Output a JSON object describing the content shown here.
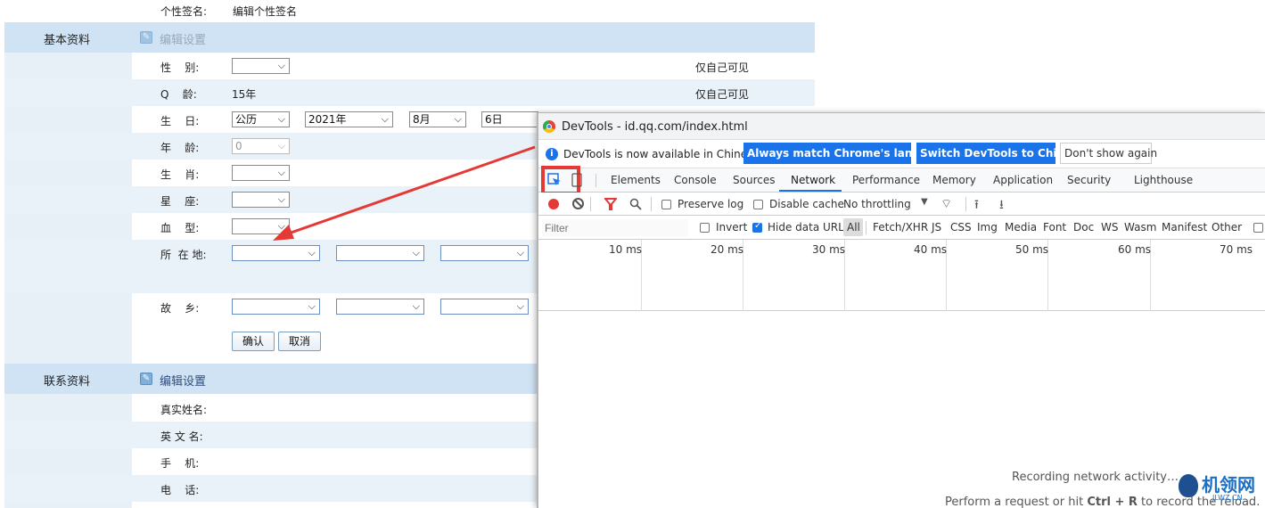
{
  "profile": {
    "signature_label": "个性签名:",
    "signature_value": "编辑个性签名",
    "basic_section": "基本资料",
    "edit_settings": "编辑设置",
    "rows": [
      {
        "label": "性    别:",
        "note": "仅自己可见"
      },
      {
        "label": "Q    龄:",
        "value": "15年",
        "note": "仅自己可见"
      },
      {
        "label": "生    日:"
      },
      {
        "label": "年    龄:"
      },
      {
        "label": "生    肖:"
      },
      {
        "label": "星    座:"
      },
      {
        "label": "血    型:"
      },
      {
        "label": "所  在 地:"
      },
      {
        "label": "故    乡:"
      }
    ],
    "birthday": {
      "calendar": "公历",
      "year": "2021年",
      "month": "8月",
      "day": "6日"
    },
    "age_value": "0",
    "confirm": "确认",
    "cancel": "取消",
    "contact_section": "联系资料",
    "contact_edit": "编辑设置",
    "contact_rows": [
      "真实姓名:",
      "英 文 名:",
      "手    机:",
      "电    话:"
    ]
  },
  "devtools": {
    "title": "DevTools - id.qq.com/index.html",
    "info_text": "DevTools is now available in Chinese!",
    "btn_match": "Always match Chrome's language",
    "btn_switch": "Switch DevTools to Chinese",
    "btn_dismiss": "Don't show again",
    "tabs": [
      "Elements",
      "Console",
      "Sources",
      "Network",
      "Performance",
      "Memory",
      "Application",
      "Security",
      "Lighthouse"
    ],
    "active_tab": "Network",
    "preserve_log": "Preserve log",
    "disable_cache": "Disable cache",
    "throttling": "No throttling",
    "filter_placeholder": "Filter",
    "invert": "Invert",
    "hide_data_urls": "Hide data URLs",
    "filter_types": [
      "All",
      "Fetch/XHR",
      "JS",
      "CSS",
      "Img",
      "Media",
      "Font",
      "Doc",
      "WS",
      "Wasm",
      "Manifest",
      "Other"
    ],
    "ticks": [
      "10 ms",
      "20 ms",
      "30 ms",
      "40 ms",
      "50 ms",
      "60 ms",
      "70 ms"
    ],
    "recording": "Recording network activity…",
    "hint_prefix": "Perform a request or hit ",
    "hint_keys": "Ctrl + R",
    "hint_suffix": " to record the reload."
  },
  "watermark": {
    "text": "机领网",
    "sub": "JLWZ.CN"
  },
  "colors": {
    "section_bg": "#cfe3f5",
    "row_alt": "#eaf2f9",
    "highlight": "#e53935",
    "blue": "#1a73e8"
  }
}
